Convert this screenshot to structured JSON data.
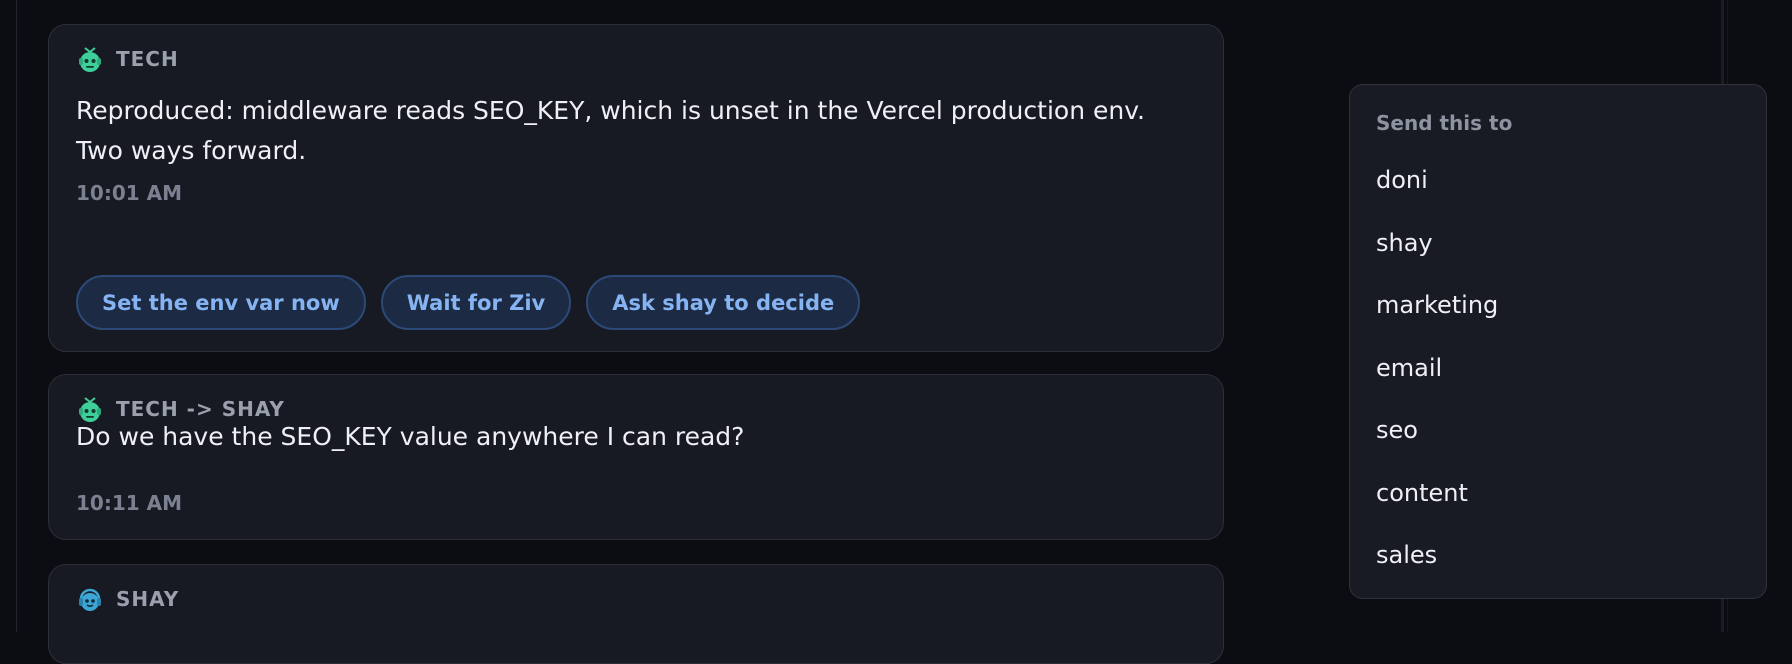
{
  "messages": [
    {
      "sender": "TECH",
      "text": "Reproduced: middleware reads SEO_KEY, which is unset in the Vercel production env. Two ways forward.",
      "time": "10:01 AM",
      "actions": [
        "Set the env var now",
        "Wait for Ziv",
        "Ask shay to decide"
      ]
    },
    {
      "sender": "TECH -> SHAY",
      "text": "Do we have the SEO_KEY value anywhere I can read?",
      "time": "10:11 AM"
    },
    {
      "sender": "SHAY"
    }
  ],
  "send_menu": {
    "title": "Send this to",
    "items": [
      "doni",
      "shay",
      "marketing",
      "email",
      "seo",
      "content",
      "sales"
    ]
  },
  "colors": {
    "tech_avatar": "#3ecf9a",
    "shay_avatar": "#3ea6d6",
    "accent": "#86b4f2"
  }
}
